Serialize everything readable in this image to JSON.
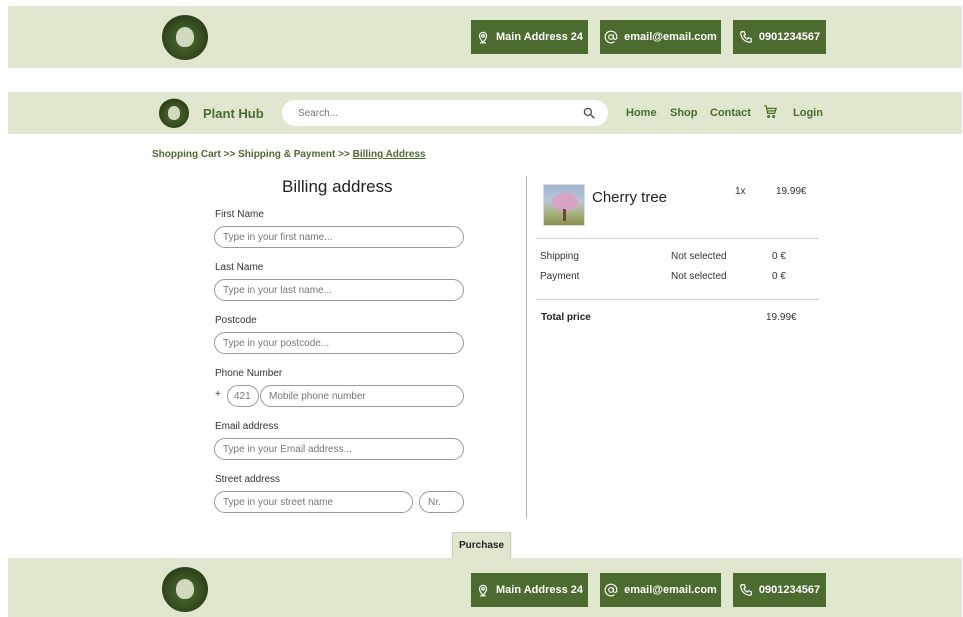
{
  "contact": {
    "address": "Main Address 24",
    "email": "email@email.com",
    "phone": "0901234567"
  },
  "nav": {
    "brand": "Plant Hub",
    "search_placeholder": "Search...",
    "links": [
      "Home",
      "Shop",
      "Contact"
    ],
    "login": "Login"
  },
  "breadcrumb": {
    "step1": "Shopping Cart",
    "sep": ">>",
    "step2": "Shipping & Payment",
    "step3": "Billing Address"
  },
  "form": {
    "title": "Billing address",
    "first_name_label": "First Name",
    "first_name_placeholder": "Type in your first name...",
    "last_name_label": "Last Name",
    "last_name_placeholder": "Type in your last name...",
    "postcode_label": "Postcode",
    "postcode_placeholder": "Type in your postcode...",
    "phone_label": "Phone Number",
    "phone_plus": "+",
    "phone_prefix_placeholder": "421",
    "phone_placeholder": "Mobile phone number",
    "email_label": "Email address",
    "email_placeholder": "Type in your Email address...",
    "street_label": "Street address",
    "street_placeholder": "Type in your street name",
    "number_placeholder": "Nr."
  },
  "summary": {
    "item_name": "Cherry tree",
    "item_qty": "1x",
    "item_price": "19.99€",
    "shipping_label": "Shipping",
    "shipping_status": "Not selected",
    "shipping_price": "0 €",
    "payment_label": "Payment",
    "payment_status": "Not selected",
    "payment_price": "0 €",
    "total_label": "Total price",
    "total_value": "19.99€"
  },
  "purchase_label": "Purchase",
  "colors": {
    "band": "#dfe8cf",
    "accent": "#4c6b2e"
  }
}
